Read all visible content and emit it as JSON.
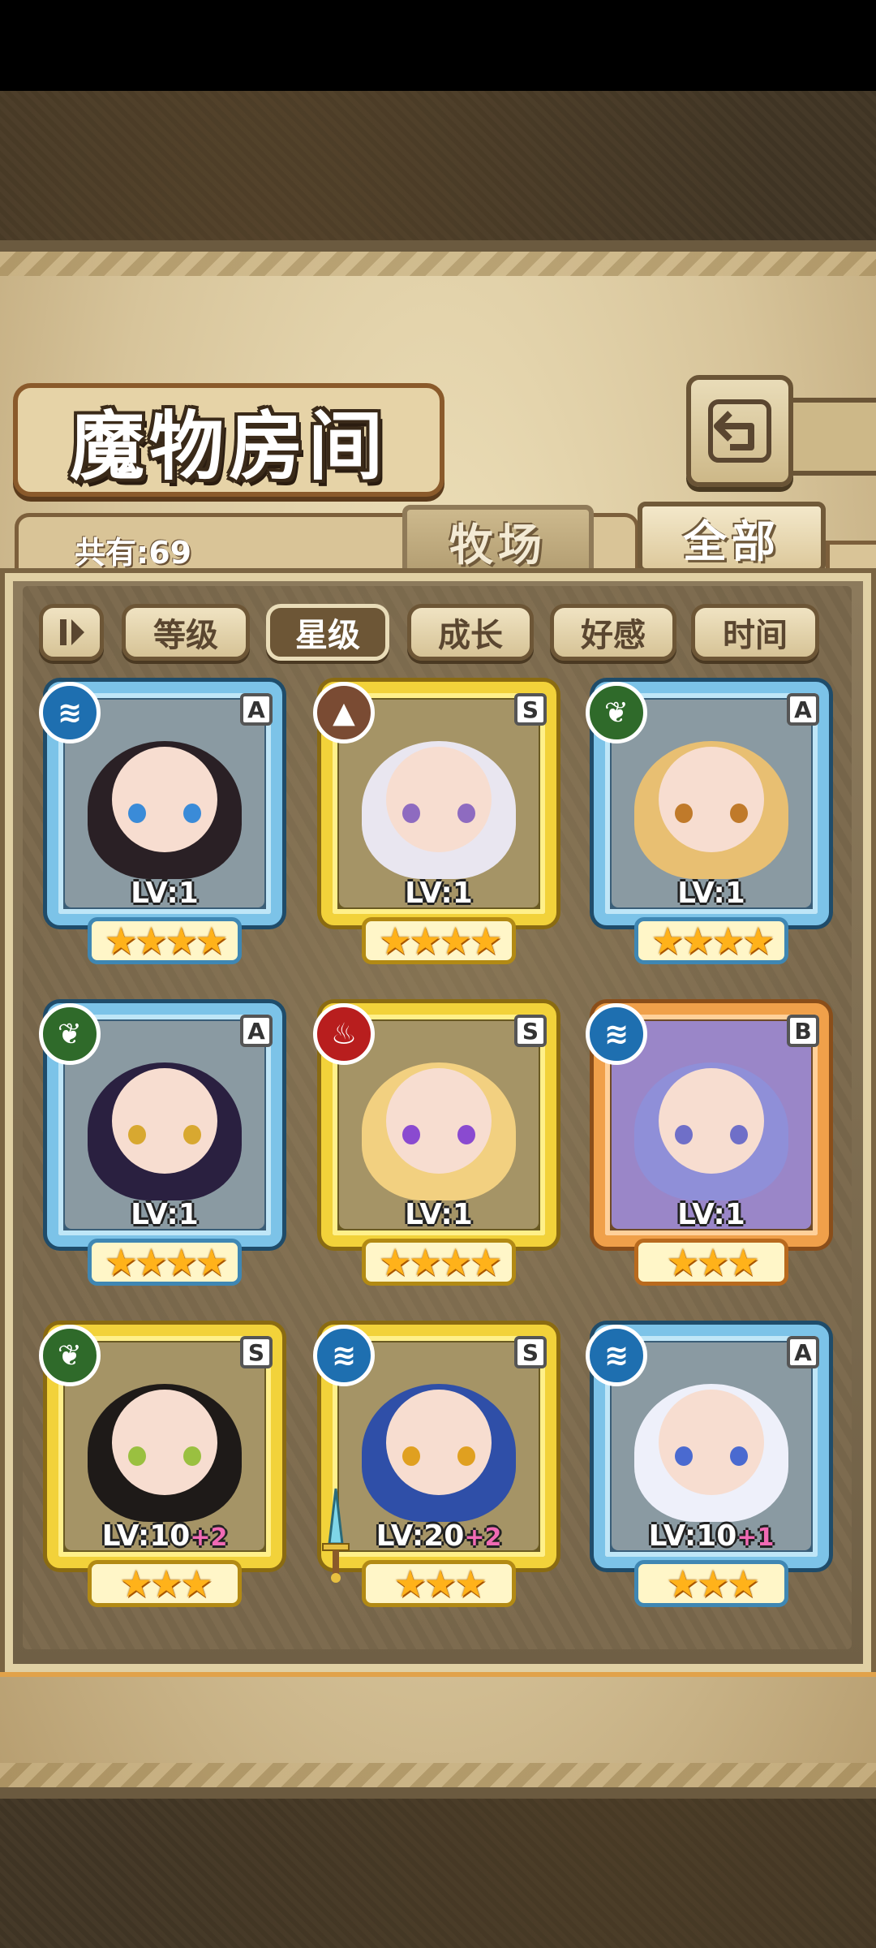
{
  "title": "魔物房间",
  "count_label": "共有:69",
  "tabs": {
    "ranch": "牧场",
    "all": "全部"
  },
  "filters": [
    "等级",
    "星级",
    "成长",
    "好感",
    "时间"
  ],
  "active_filter": "星级",
  "cards": [
    {
      "element": "water",
      "rank": "A",
      "level": "LV:1",
      "plus": "",
      "stars": "★★★★",
      "frame": "blue",
      "hair": "#2a2025",
      "eye": "#3a8bd8"
    },
    {
      "element": "earth",
      "rank": "S",
      "level": "LV:1",
      "plus": "",
      "stars": "★★★★",
      "frame": "gold",
      "hair": "#e9e6f0",
      "eye": "#8e6bc0"
    },
    {
      "element": "wood",
      "rank": "A",
      "level": "LV:1",
      "plus": "",
      "stars": "★★★★",
      "frame": "blue",
      "hair": "#e8bf72",
      "eye": "#c07a2a"
    },
    {
      "element": "wood",
      "rank": "A",
      "level": "LV:1",
      "plus": "",
      "stars": "★★★★",
      "frame": "blue",
      "hair": "#2a2040",
      "eye": "#d8a830"
    },
    {
      "element": "fire",
      "rank": "S",
      "level": "LV:1",
      "plus": "",
      "stars": "★★★★",
      "frame": "gold",
      "hair": "#f2d080",
      "eye": "#8a4ad0"
    },
    {
      "element": "water",
      "rank": "B",
      "level": "LV:1",
      "plus": "",
      "stars": "★★★",
      "frame": "orange",
      "hair": "#8f8fd8",
      "eye": "#6f6fc8"
    },
    {
      "element": "wood",
      "rank": "S",
      "level": "LV:10",
      "plus": "+2",
      "stars": "★★★",
      "frame": "gold",
      "hair": "#1e1a18",
      "eye": "#9ac040"
    },
    {
      "element": "water",
      "rank": "S",
      "level": "LV:20",
      "plus": "+2",
      "stars": "★★★",
      "frame": "gold",
      "hair": "#2f4fa8",
      "eye": "#e0a020"
    },
    {
      "element": "water",
      "rank": "A",
      "level": "LV:10",
      "plus": "+1",
      "stars": "★★★",
      "frame": "blue",
      "hair": "#eef0fa",
      "eye": "#4a6ad0"
    }
  ],
  "colors": {
    "panel": "#d7c49a",
    "frame_border": "#7a6442",
    "active_filter_bg": "#6d5636"
  }
}
